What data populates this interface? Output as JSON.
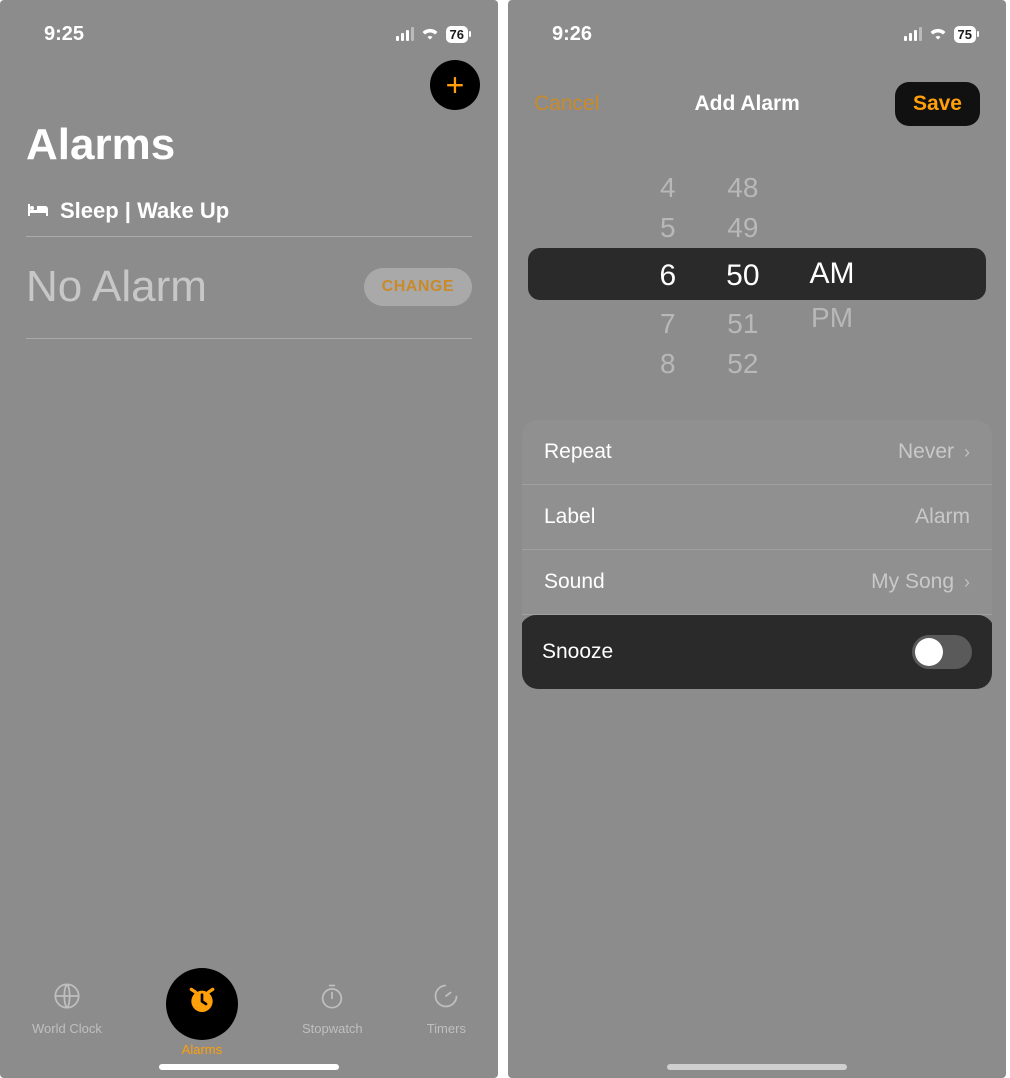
{
  "left": {
    "status": {
      "time": "9:25",
      "battery": "76"
    },
    "add_button_glyph": "+",
    "title": "Alarms",
    "sleep_section_label": "Sleep | Wake Up",
    "no_alarm_text": "No Alarm",
    "change_label": "CHANGE",
    "tabs": {
      "world_clock": "World Clock",
      "alarms": "Alarms",
      "stopwatch": "Stopwatch",
      "timers": "Timers"
    }
  },
  "right": {
    "status": {
      "time": "9:26",
      "battery": "75"
    },
    "cancel_label": "Cancel",
    "modal_title": "Add Alarm",
    "save_label": "Save",
    "picker": {
      "hours": [
        "4",
        "5",
        "6",
        "7",
        "8"
      ],
      "minutes": [
        "48",
        "49",
        "50",
        "51",
        "52"
      ],
      "ampm": [
        "AM",
        "PM"
      ],
      "selected_hour_index": 2,
      "selected_minute_index": 2,
      "selected_ampm_index": 0
    },
    "rows": {
      "repeat_label": "Repeat",
      "repeat_value": "Never",
      "label_label": "Label",
      "label_value": "Alarm",
      "sound_label": "Sound",
      "sound_value": "My Song",
      "snooze_label": "Snooze",
      "snooze_on": false
    }
  }
}
